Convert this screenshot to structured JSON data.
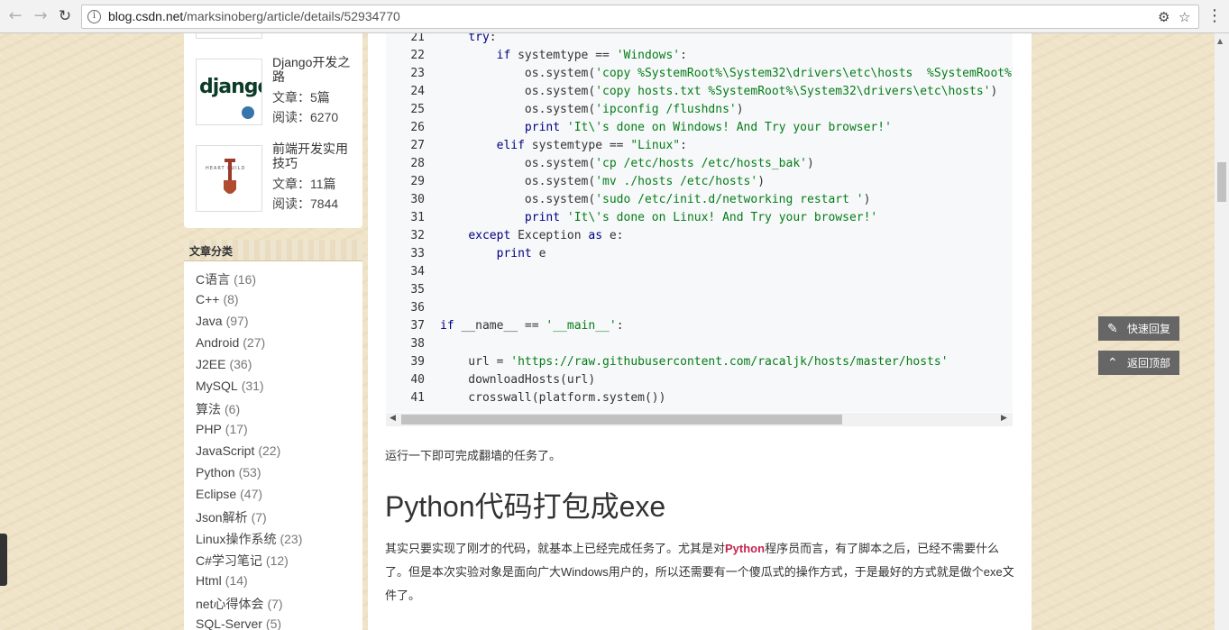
{
  "browser": {
    "url_host": "blog.csdn.net",
    "url_path": "/marksinoberg/article/details/52934770"
  },
  "sidebar": {
    "blogs": [
      {
        "title": "Django开发之路",
        "thumb_text": "django",
        "articles": "文章：5篇",
        "reads": "阅读：6270"
      },
      {
        "title": "前端开发实用技巧",
        "thumb_text": "HEART BUILD",
        "articles": "文章：11篇",
        "reads": "阅读：7844"
      }
    ],
    "categories_title": "文章分类",
    "categories": [
      {
        "name": "C语言",
        "count": "(16)"
      },
      {
        "name": "C++",
        "count": "(8)"
      },
      {
        "name": "Java",
        "count": "(97)"
      },
      {
        "name": "Android",
        "count": "(27)"
      },
      {
        "name": "J2EE",
        "count": "(36)"
      },
      {
        "name": "MySQL",
        "count": "(31)"
      },
      {
        "name": "算法",
        "count": "(6)"
      },
      {
        "name": "PHP",
        "count": "(17)"
      },
      {
        "name": "JavaScript",
        "count": "(22)"
      },
      {
        "name": "Python",
        "count": "(53)"
      },
      {
        "name": "Eclipse",
        "count": "(47)"
      },
      {
        "name": "Json解析",
        "count": "(7)"
      },
      {
        "name": "Linux操作系统",
        "count": "(23)"
      },
      {
        "name": "C#学习笔记",
        "count": "(12)"
      },
      {
        "name": "Html",
        "count": "(14)"
      },
      {
        "name": "net心得体会",
        "count": "(7)"
      },
      {
        "name": "SQL-Server",
        "count": "(5)"
      }
    ]
  },
  "code": {
    "lines": [
      {
        "n": "21",
        "parts": [
          [
            "    ",
            ""
          ],
          [
            "try",
            ""
          ],
          [
            ":",
            ""
          ]
        ]
      },
      {
        "n": "22",
        "parts": [
          [
            "        if systemtype == ",
            ""
          ],
          [
            "'Windows'",
            "str"
          ],
          [
            ":",
            ""
          ]
        ]
      },
      {
        "n": "23",
        "parts": [
          [
            "            os.system(",
            ""
          ],
          [
            "'copy %SystemRoot%\\System32\\drivers\\etc\\hosts  %SystemRoot%\\S",
            "str"
          ]
        ]
      },
      {
        "n": "24",
        "parts": [
          [
            "            os.system(",
            ""
          ],
          [
            "'copy hosts.txt %SystemRoot%\\System32\\drivers\\etc\\hosts'",
            "str"
          ],
          [
            ")",
            ""
          ]
        ]
      },
      {
        "n": "25",
        "parts": [
          [
            "            os.system(",
            ""
          ],
          [
            "'ipconfig /flushdns'",
            "str"
          ],
          [
            ")",
            ""
          ]
        ]
      },
      {
        "n": "26",
        "parts": [
          [
            "            print ",
            ""
          ],
          [
            "'It\\'s done on Windows! And Try your browser!'",
            "str"
          ]
        ]
      },
      {
        "n": "27",
        "parts": [
          [
            "        elif systemtype == ",
            ""
          ],
          [
            "\"Linux\"",
            "str"
          ],
          [
            ":",
            ""
          ]
        ]
      },
      {
        "n": "28",
        "parts": [
          [
            "            os.system(",
            ""
          ],
          [
            "'cp /etc/hosts /etc/hosts_bak'",
            "str"
          ],
          [
            ")",
            ""
          ]
        ]
      },
      {
        "n": "29",
        "parts": [
          [
            "            os.system(",
            ""
          ],
          [
            "'mv ./hosts /etc/hosts'",
            "str"
          ],
          [
            ")",
            ""
          ]
        ]
      },
      {
        "n": "30",
        "parts": [
          [
            "            os.system(",
            ""
          ],
          [
            "'sudo /etc/init.d/networking restart '",
            "str"
          ],
          [
            ")",
            ""
          ]
        ]
      },
      {
        "n": "31",
        "parts": [
          [
            "            print ",
            ""
          ],
          [
            "'It\\'s done on Linux! And Try your browser!'",
            "str"
          ]
        ]
      },
      {
        "n": "32",
        "parts": [
          [
            "    except Exception as e:",
            ""
          ]
        ]
      },
      {
        "n": "33",
        "parts": [
          [
            "        print e",
            ""
          ]
        ]
      },
      {
        "n": "34",
        "parts": [
          [
            "",
            ""
          ]
        ]
      },
      {
        "n": "35",
        "parts": [
          [
            "",
            ""
          ]
        ]
      },
      {
        "n": "36",
        "parts": [
          [
            "",
            ""
          ]
        ]
      },
      {
        "n": "37",
        "parts": [
          [
            "if __name__ == ",
            ""
          ],
          [
            "'__main__'",
            "str"
          ],
          [
            ":",
            ""
          ]
        ]
      },
      {
        "n": "38",
        "parts": [
          [
            "",
            ""
          ]
        ]
      },
      {
        "n": "39",
        "parts": [
          [
            "    url = ",
            ""
          ],
          [
            "'https://raw.githubusercontent.com/racaljk/hosts/master/hosts'",
            "str"
          ]
        ]
      },
      {
        "n": "40",
        "parts": [
          [
            "    downloadHosts(url)",
            ""
          ]
        ]
      },
      {
        "n": "41",
        "parts": [
          [
            "    crosswall(platform.system())",
            ""
          ]
        ]
      }
    ]
  },
  "article": {
    "run_note": "运行一下即可完成翻墙的任务了。",
    "heading": "Python代码打包成exe",
    "para_before": "其实只要实现了刚才的代码，就基本上已经完成任务了。尤其是对",
    "para_highlight": "Python",
    "para_after": "程序员而言，有了脚本之后，已经不需要什么了。但是本次实验对象是面向广大Windows用户的，所以还需要有一个傻瓜式的操作方式，于是最好的方式就是做个exe文件了。"
  },
  "floating": {
    "quick_reply": "快速回复",
    "back_to_top": "返回顶部"
  }
}
